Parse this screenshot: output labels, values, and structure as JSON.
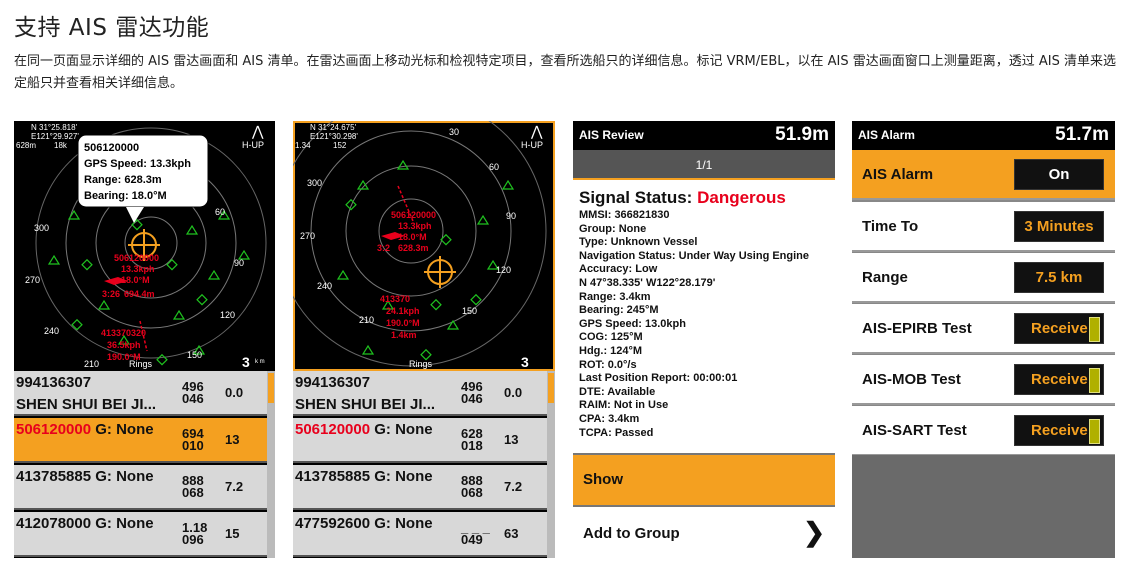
{
  "title": "支持 AIS 雷达功能",
  "description": "在同一页面显示详细的 AIS 雷达画面和 AIS 清单。在雷达画面上移动光标和检视特定项目，查看所选船只的详细信息。标记 VRM/EBL，以在 AIS 雷达画面窗口上测量距离，透过 AIS 清单来选定船只并查看相关详细信息。",
  "colors": {
    "accent": "#f4a020",
    "danger": "#e8001c",
    "target_green": "#1fc11f"
  },
  "screen1": {
    "coords": [
      "N 31°25.818'",
      "E121°29.927'"
    ],
    "zoom": "628m",
    "zoom2": "18k",
    "orientation": "H-UP",
    "tooltip": [
      "506120000",
      "GPS Speed: 13.3kph",
      "Range: 628.3m",
      "Bearing: 18.0°M"
    ],
    "bearings": [
      "300",
      "270",
      "240",
      "210",
      "60",
      "90",
      "120",
      "150"
    ],
    "labels": [
      [
        "506120000",
        "13.3kph",
        "18.0°M",
        "3:26",
        "694.4m"
      ],
      [
        "413370320",
        "36.5kph",
        "190.0°M"
      ]
    ],
    "rings_label": "Rings",
    "range": "3",
    "range_unit": "k m",
    "list": [
      {
        "l1": "994136307",
        "l2": "SHEN SHUI BEI JI...",
        "n1a": "496",
        "n1b": "046",
        "n2": "0.0"
      },
      {
        "l1": "506120000",
        "l1b": "G: None",
        "n1a": "694",
        "n1b": "010",
        "n2": "13"
      },
      {
        "l1": "413785885",
        "l1b": "G: None",
        "n1a": "888",
        "n1b": "068",
        "n2": "7.2"
      },
      {
        "l1": "412078000",
        "l1b": "G: None",
        "n1a": "1.18",
        "n1b": "096",
        "n2": "15"
      }
    ]
  },
  "screen2": {
    "coords": [
      "N 31°24.675'",
      "E121°30.298'"
    ],
    "zoom": "1.34",
    "zoom2": "152",
    "orientation": "H-UP",
    "bearings": [
      "300",
      "270",
      "240",
      "210",
      "30",
      "60",
      "90",
      "120",
      "150"
    ],
    "labels": [
      [
        "506120000",
        "13.3kph",
        "18.0°M",
        "628.3m",
        "3:2"
      ],
      [
        "413370",
        "24.1kph",
        "190.0°M",
        "1.4km"
      ]
    ],
    "rings_label": "Rings",
    "range": "3",
    "list": [
      {
        "l1": "994136307",
        "l2": "SHEN SHUI BEI JI...",
        "n1a": "496",
        "n1b": "046",
        "n2": "0.0"
      },
      {
        "l1": "506120000",
        "l1b": "G: None",
        "n1a": "628",
        "n1b": "018",
        "n2": "13"
      },
      {
        "l1": "413785885",
        "l1b": "G: None",
        "n1a": "888",
        "n1b": "068",
        "n2": "7.2"
      },
      {
        "l1": "477592600",
        "l1b": "G: None",
        "n1a": "_ _ _",
        "n1b": "049",
        "n2": "63"
      }
    ]
  },
  "screen3": {
    "header_title": "AIS Review",
    "header_value": "51.9m",
    "pager": "1/1",
    "signal_label": "Signal Status:",
    "signal_value": "Dangerous",
    "details": [
      "MMSI: 366821830",
      "Group: None",
      "Type: Unknown Vessel",
      "Navigation Status: Under Way Using Engine",
      "Accuracy: Low",
      "N  47°38.335' W122°28.179'",
      "Range: 3.4km",
      "Bearing: 245°M",
      "GPS Speed: 13.0kph",
      "COG: 125°M",
      "Hdg.: 124°M",
      "ROT: 0.0°/s",
      "Last Position Report: 00:00:01",
      "DTE: Available",
      "RAIM: Not in Use",
      "CPA: 3.4km",
      "TCPA: Passed"
    ],
    "show_label": "Show",
    "add_group_label": "Add to Group"
  },
  "screen4": {
    "header_title": "AIS Alarm",
    "header_value": "51.7m",
    "rows": [
      {
        "key": "AIS Alarm",
        "value": "On"
      },
      {
        "key": "Time To",
        "value": "3 Minutes"
      },
      {
        "key": "Range",
        "value": "7.5 km"
      },
      {
        "key": "AIS-EPIRB Test",
        "value": "Receive"
      },
      {
        "key": "AIS-MOB Test",
        "value": "Receive"
      },
      {
        "key": "AIS-SART Test",
        "value": "Receive"
      }
    ]
  }
}
